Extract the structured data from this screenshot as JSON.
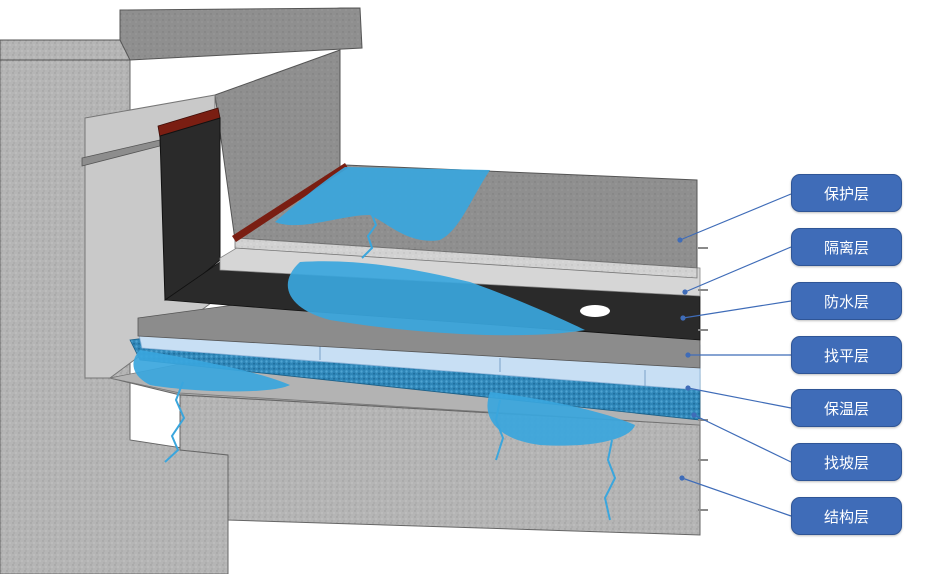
{
  "layers": [
    {
      "id": "protection",
      "label": "保护层"
    },
    {
      "id": "isolation",
      "label": "隔离层"
    },
    {
      "id": "waterproof",
      "label": "防水层"
    },
    {
      "id": "leveling",
      "label": "找平层"
    },
    {
      "id": "insulation",
      "label": "保温层"
    },
    {
      "id": "slope",
      "label": "找坡层"
    },
    {
      "id": "structure",
      "label": "结构层"
    }
  ],
  "colors": {
    "label_bg": "#3f6cb8",
    "leader": "#3f6cb8",
    "water": "#3aa6dd",
    "concrete": "#a9a9a9",
    "membrane": "#2a2a2a",
    "insulation_board": "#c8dff4"
  }
}
